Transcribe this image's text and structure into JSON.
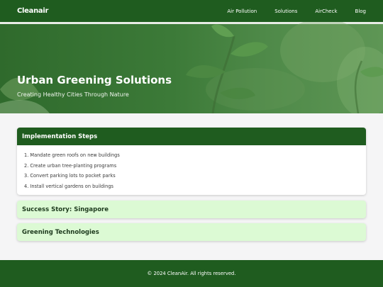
{
  "nav": {
    "logo": "Cleanair",
    "links": [
      "Air Pollution",
      "Solutions",
      "AirCheck",
      "Blog"
    ]
  },
  "hero": {
    "title": "Urban Greening Solutions",
    "subtitle": "Creating Healthy Cities Through Nature"
  },
  "accordion": [
    {
      "title": "Implementation Steps",
      "expanded": true,
      "steps": [
        "1. Mandate green roofs on new buildings",
        "2. Create urban tree-planting programs",
        "3. Convert parking lots to pocket parks",
        "4. Install vertical gardens on buildings"
      ]
    },
    {
      "title": "Success Story: Singapore",
      "expanded": false
    },
    {
      "title": "Greening Technologies",
      "expanded": false
    }
  ],
  "footer": {
    "text": "© 2024 CleanAir. All rights reserved."
  },
  "colors": {
    "primary": "#1f5c1f",
    "collapsed_panel": "#dcfad4",
    "background": "#f5f5f6"
  }
}
